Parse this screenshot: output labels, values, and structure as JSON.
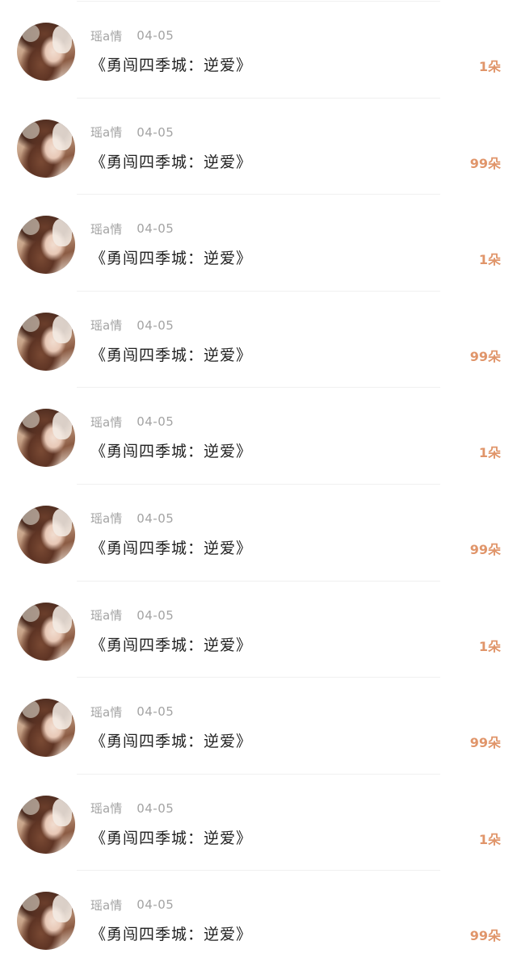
{
  "colors": {
    "background": "#ffffff",
    "divider": "#f0f0f0",
    "meta_text": "#a3a3a3",
    "title_text": "#222222",
    "amount_text": "#e0956a"
  },
  "gifts": [
    {
      "username": "瑶a情",
      "date": "04-05",
      "title": "《勇闯四季城：逆爱》",
      "amount": "1朵"
    },
    {
      "username": "瑶a情",
      "date": "04-05",
      "title": "《勇闯四季城：逆爱》",
      "amount": "99朵"
    },
    {
      "username": "瑶a情",
      "date": "04-05",
      "title": "《勇闯四季城：逆爱》",
      "amount": "1朵"
    },
    {
      "username": "瑶a情",
      "date": "04-05",
      "title": "《勇闯四季城：逆爱》",
      "amount": "99朵"
    },
    {
      "username": "瑶a情",
      "date": "04-05",
      "title": "《勇闯四季城：逆爱》",
      "amount": "1朵"
    },
    {
      "username": "瑶a情",
      "date": "04-05",
      "title": "《勇闯四季城：逆爱》",
      "amount": "99朵"
    },
    {
      "username": "瑶a情",
      "date": "04-05",
      "title": "《勇闯四季城：逆爱》",
      "amount": "1朵"
    },
    {
      "username": "瑶a情",
      "date": "04-05",
      "title": "《勇闯四季城：逆爱》",
      "amount": "99朵"
    },
    {
      "username": "瑶a情",
      "date": "04-05",
      "title": "《勇闯四季城：逆爱》",
      "amount": "1朵"
    },
    {
      "username": "瑶a情",
      "date": "04-05",
      "title": "《勇闯四季城：逆爱》",
      "amount": "99朵"
    }
  ]
}
